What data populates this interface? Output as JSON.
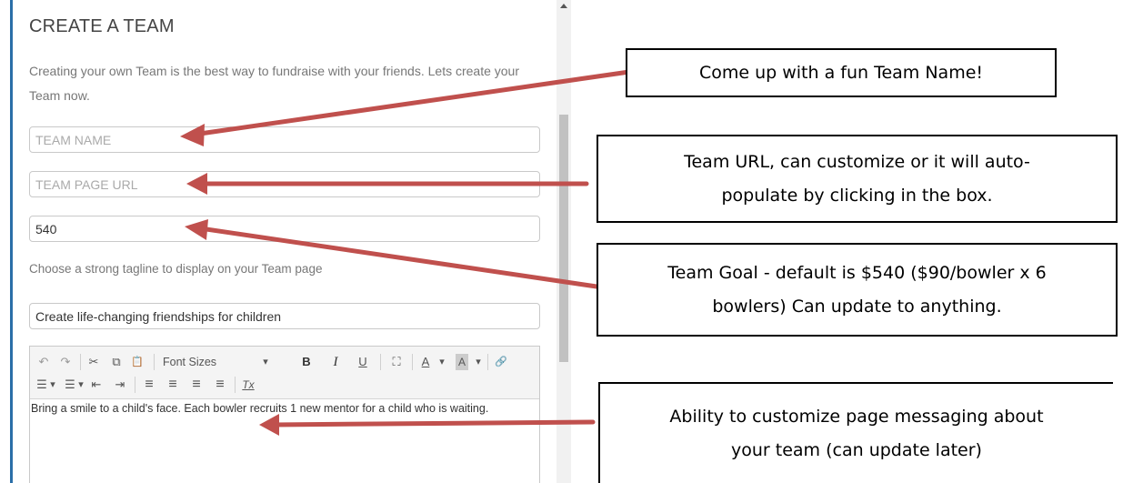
{
  "form": {
    "title": "CREATE A TEAM",
    "intro": "Creating your own Team is the best way to fundraise with your friends. Lets create your Team now.",
    "team_name": {
      "placeholder": "TEAM NAME",
      "value": ""
    },
    "team_url": {
      "placeholder": "TEAM PAGE URL",
      "value": ""
    },
    "team_goal": {
      "value": "540"
    },
    "tagline_label": "Choose a strong tagline to display on your Team page",
    "tagline": {
      "value": "Create life-changing friendships for children"
    },
    "editor": {
      "toolbar": {
        "undo": "↶",
        "redo": "↷",
        "cut": "✂",
        "copy": "⧉",
        "paste": "📋",
        "font_sizes": "Font Sizes",
        "dropdown": "▾",
        "bold": "B",
        "italic": "I",
        "underline": "U",
        "maximize": "⛶",
        "text_color": "A",
        "bg_color": "A",
        "link": "🔗",
        "bullets": "☰",
        "numbers": "☰",
        "outdent": "⇤",
        "indent": "⇥",
        "align_left": "≡",
        "align_center": "≡",
        "align_right": "≡",
        "justify": "≡",
        "clear_format": "Tx"
      },
      "body": "Bring a smile to a child's face. Each bowler recruits 1 new mentor for a child who is waiting."
    }
  },
  "callouts": {
    "team_name": "Come up with a fun Team Name!",
    "team_url_line1": "Team URL, can customize or it will auto-",
    "team_url_line2": "populate by clicking in the box.",
    "team_goal_line1": "Team Goal - default is $540 ($90/bowler x 6",
    "team_goal_line2": "bowlers) Can update to anything.",
    "message_line1": "Ability to customize page messaging about",
    "message_line2": "your team (can update later)"
  },
  "colors": {
    "arrow": "#c0504d",
    "accent_rule": "#2b6fa8"
  }
}
